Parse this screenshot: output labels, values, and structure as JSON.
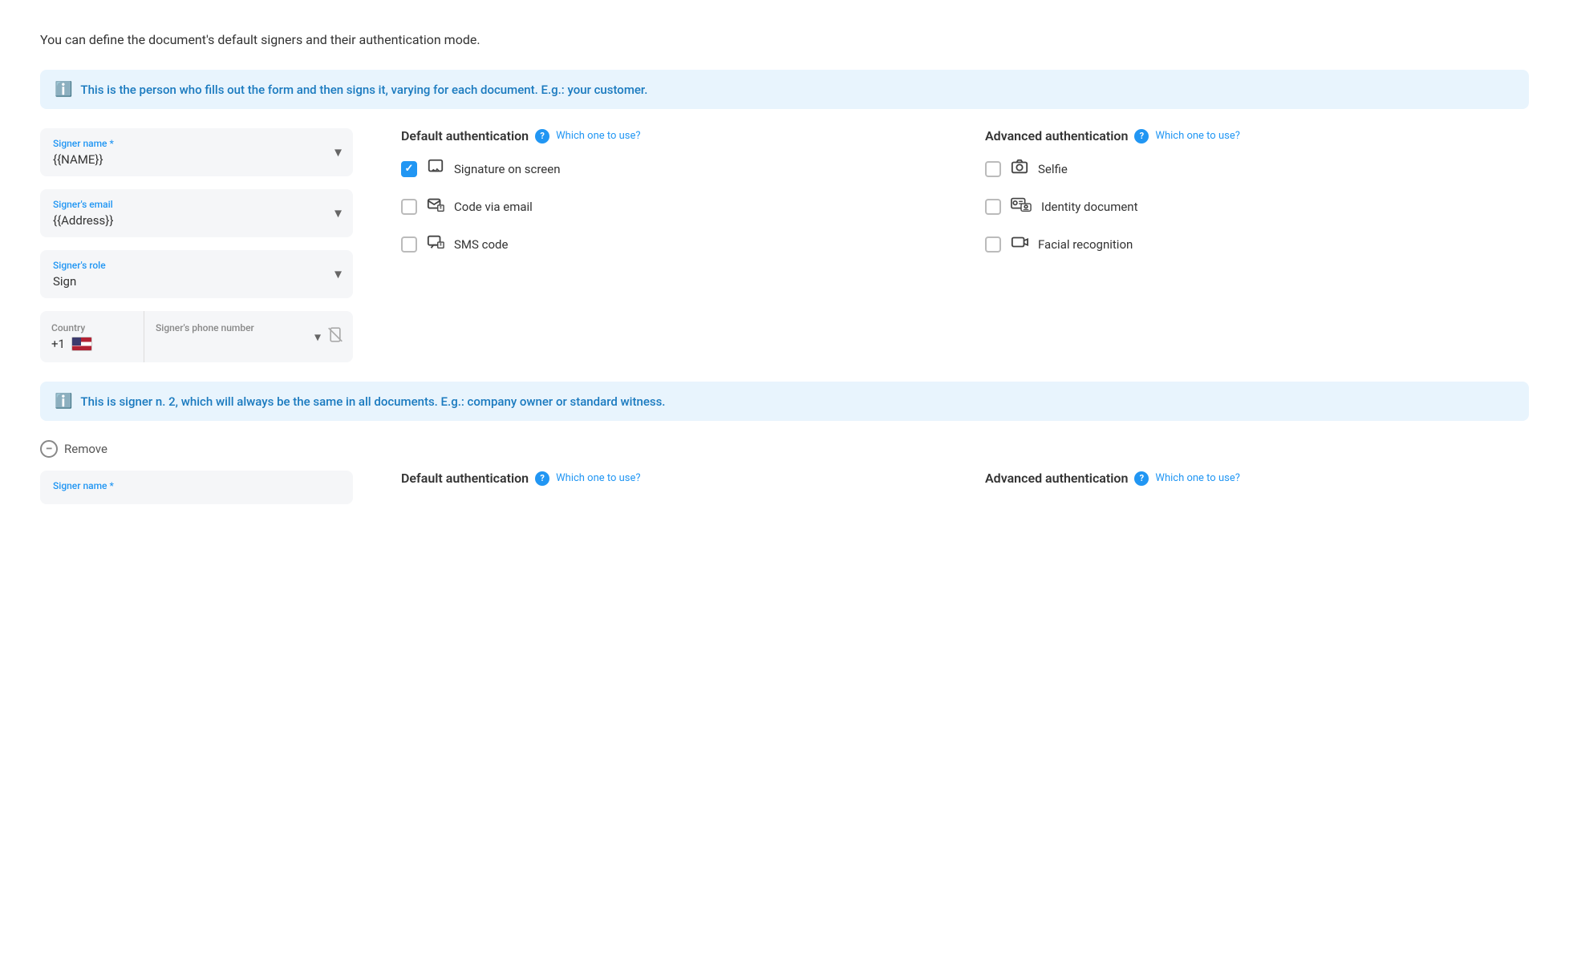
{
  "page": {
    "description": "You can define the document's default signers and their authentication mode."
  },
  "signer1": {
    "info_banner": "This is the person who fills out the form and then signs it, varying for each document. E.g.: your customer.",
    "name_label": "Signer name *",
    "name_value": "{{NAME}}",
    "email_label": "Signer's email",
    "email_value": "{{Address}}",
    "role_label": "Signer's role",
    "role_value": "Sign",
    "phone_country_label": "Country",
    "phone_country_value": "+1",
    "phone_number_label": "Signer's phone number"
  },
  "auth1": {
    "default_title": "Default authentication",
    "default_which": "Which one to use?",
    "advanced_title": "Advanced authentication",
    "advanced_which": "Which one to use?",
    "default_options": [
      {
        "label": "Signature on screen",
        "checked": true
      },
      {
        "label": "Code via email",
        "checked": false
      },
      {
        "label": "SMS code",
        "checked": false
      }
    ],
    "advanced_options": [
      {
        "label": "Selfie",
        "checked": false
      },
      {
        "label": "Identity document",
        "checked": false
      },
      {
        "label": "Facial recognition",
        "checked": false
      }
    ]
  },
  "signer2": {
    "info_banner": "This is signer n. 2, which will always be the same in all documents. E.g.: company owner or standard witness.",
    "remove_label": "Remove",
    "name_label": "Signer name *",
    "default_title": "Default authentication",
    "default_which": "Which one to use?",
    "advanced_title": "Advanced authentication",
    "advanced_which": "Which one to use?"
  },
  "icons": {
    "info": "ℹ",
    "dropdown": "▾",
    "help": "?",
    "minus": "−",
    "pencil": "✏",
    "email_lock": "📧",
    "sms": "💬",
    "camera": "📷",
    "id_card": "🪪",
    "video": "🎥",
    "no_phone": "📵"
  }
}
